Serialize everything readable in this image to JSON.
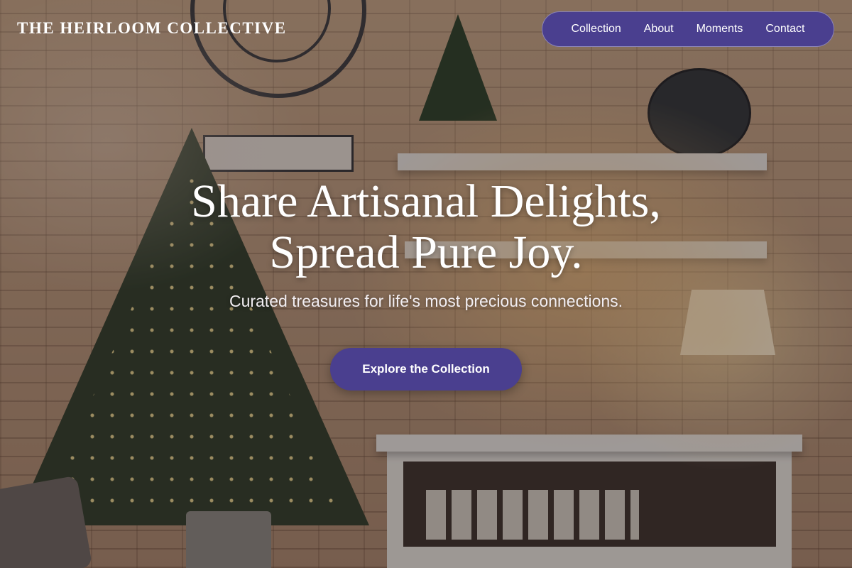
{
  "header": {
    "brand": "THE HEIRLOOM COLLECTIVE",
    "nav": [
      {
        "label": "Collection"
      },
      {
        "label": "About"
      },
      {
        "label": "Moments"
      },
      {
        "label": "Contact"
      }
    ]
  },
  "hero": {
    "headline_line1": "Share Artisanal Delights,",
    "headline_line2": "Spread Pure Joy.",
    "subtitle": "Curated treasures for life's most precious connections.",
    "cta_label": "Explore the Collection",
    "background_image": "cozy shop interior with decorated christmas tree, brick wall and shelves"
  },
  "colors": {
    "accent": "#4a3f8f",
    "text": "#ffffff"
  }
}
